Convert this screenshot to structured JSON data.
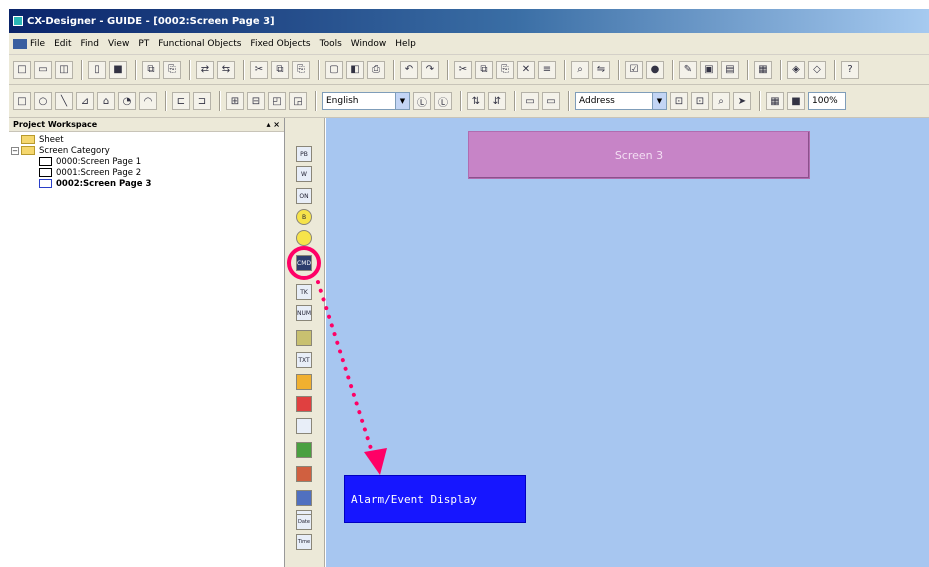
{
  "window": {
    "title": "CX-Designer - GUIDE - [0002:Screen Page 3]"
  },
  "menu": [
    "File",
    "Edit",
    "Find",
    "View",
    "PT",
    "Functional Objects",
    "Fixed Objects",
    "Tools",
    "Window",
    "Help"
  ],
  "toolbar": {
    "language": "English",
    "address_mode": "Address",
    "zoom": "100%"
  },
  "workspace": {
    "title": "Project Workspace",
    "close_glyph": "▴ ×",
    "tree": {
      "sheet": "Sheet",
      "category": "Screen Category",
      "pages": [
        "0000:Screen Page 1",
        "0001:Screen Page 2",
        "0002:Screen Page 3"
      ]
    }
  },
  "object_toolbar": [
    "PB",
    "W",
    "ON",
    "B",
    "",
    "CMD",
    "TK",
    "NUM",
    "",
    "TXT",
    "",
    "",
    "",
    "",
    "",
    "",
    "",
    "Date",
    "Time"
  ],
  "canvas": {
    "screen_button": "Screen 3",
    "alarm_display": "Alarm/Event Display"
  },
  "colors": {
    "canvas_bg": "#a7c6f0",
    "screen_button": "#c784c7",
    "alarm_box": "#1616ff",
    "annotation": "#ff0066"
  },
  "icons": [
    "app-icon",
    "new-icon",
    "open-icon",
    "save-icon",
    "copy-icon",
    "paste-icon",
    "undo-icon",
    "redo-icon",
    "find-icon",
    "help-icon",
    "rectangle-icon",
    "circle-icon",
    "line-icon",
    "polygon-icon"
  ]
}
